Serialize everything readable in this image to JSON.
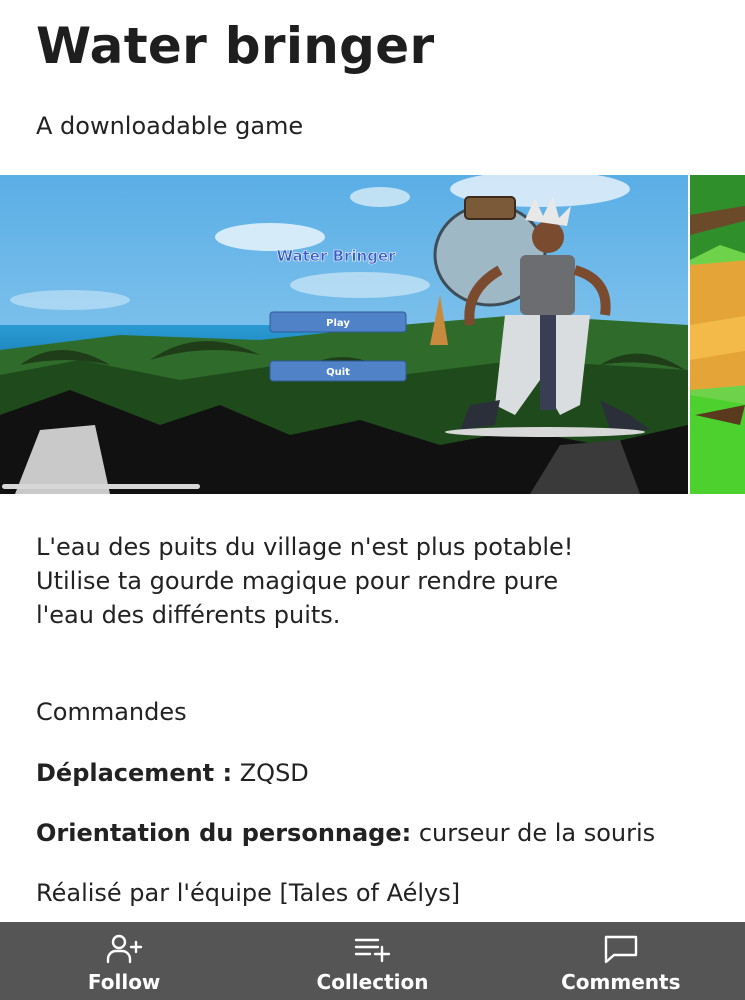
{
  "game": {
    "title": "Water bringer",
    "subtitle": "A downloadable game"
  },
  "screenshot": {
    "in_game_title": "Water Bringer",
    "menu_buttons": [
      "Play",
      "Quit"
    ]
  },
  "description": {
    "lines": [
      "L'eau des puits du village  n'est plus potable!",
      "Utilise ta gourde magique pour rendre pure",
      "l'eau des différents puits."
    ],
    "commands_heading": "Commandes",
    "movement_label": "Déplacement :",
    "movement_value": " ZQSD",
    "orientation_label": "Orientation du personnage:",
    "orientation_value": " curseur de la souris",
    "credits": "Réalisé par  l'équipe [Tales of Aélys]"
  },
  "bottom_bar": {
    "items": [
      {
        "label": "Follow",
        "icon": "user-plus-icon"
      },
      {
        "label": "Collection",
        "icon": "list-plus-icon"
      },
      {
        "label": "Comments",
        "icon": "comment-icon"
      }
    ]
  },
  "colors": {
    "bar_background": "#555555",
    "text": "#222222",
    "menu_button": "#4f82c6"
  }
}
